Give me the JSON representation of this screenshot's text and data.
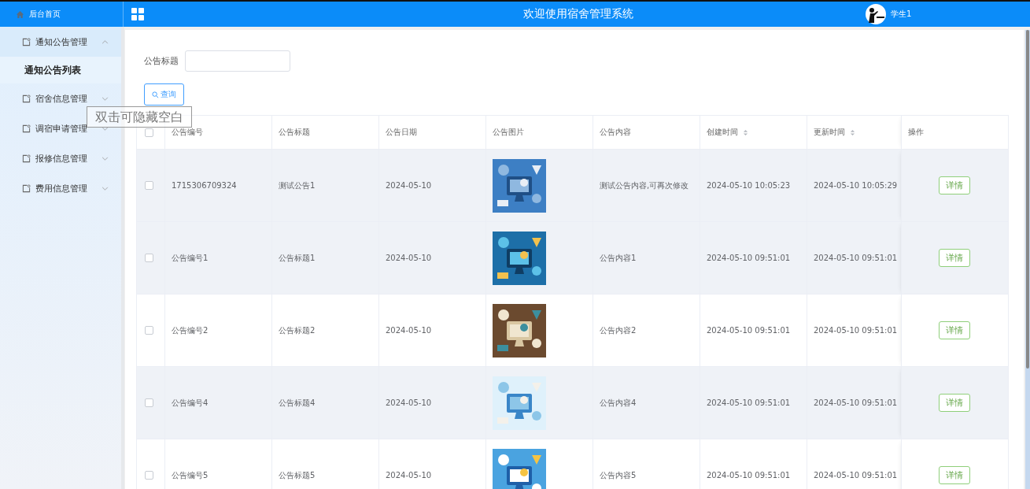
{
  "header": {
    "home_label": "后台首页",
    "title": "欢迎使用宿舍管理系统",
    "user": "学生1"
  },
  "sidebar": {
    "items": [
      {
        "label": "通知公告管理",
        "expanded": true,
        "children": [
          {
            "label": "通知公告列表",
            "selected": true
          }
        ]
      },
      {
        "label": "宿舍信息管理",
        "expanded": false
      },
      {
        "label": "调宿申请管理",
        "expanded": false
      },
      {
        "label": "报修信息管理",
        "expanded": false
      },
      {
        "label": "费用信息管理",
        "expanded": false
      }
    ]
  },
  "tooltip": "双击可隐藏空白",
  "search": {
    "label": "公告标题",
    "button": "查询"
  },
  "table": {
    "select_all_checked": false,
    "columns": [
      {
        "label": "公告编号",
        "sortable": false
      },
      {
        "label": "公告标题",
        "sortable": false
      },
      {
        "label": "公告日期",
        "sortable": false
      },
      {
        "label": "公告图片",
        "sortable": false
      },
      {
        "label": "公告内容",
        "sortable": false
      },
      {
        "label": "创建时间",
        "sortable": true
      },
      {
        "label": "更新时间",
        "sortable": true
      },
      {
        "label": "操作",
        "sortable": false
      }
    ],
    "rows": [
      {
        "highlighted": true,
        "checked": false,
        "cells": [
          {
            "kind": "text",
            "text": "1715306709324"
          },
          {
            "kind": "text",
            "text": "测试公告1"
          },
          {
            "kind": "text",
            "text": "2024-05-10"
          },
          {
            "kind": "picture"
          },
          {
            "kind": "text",
            "text": "测试公告内容,可再次修改"
          },
          {
            "kind": "text",
            "text": "2024-05-10 10:05:23"
          },
          {
            "kind": "text",
            "text": "2024-05-10 10:05:29"
          },
          {
            "kind": "button",
            "text": "详情"
          }
        ]
      },
      {
        "highlighted": true,
        "checked": false,
        "cells": [
          {
            "kind": "text",
            "text": "公告编号1"
          },
          {
            "kind": "text",
            "text": "公告标题1"
          },
          {
            "kind": "text",
            "text": "2024-05-10"
          },
          {
            "kind": "picture"
          },
          {
            "kind": "text",
            "text": "公告内容1"
          },
          {
            "kind": "text",
            "text": "2024-05-10 09:51:01"
          },
          {
            "kind": "text",
            "text": "2024-05-10 09:51:01"
          },
          {
            "kind": "button",
            "text": "详情"
          }
        ]
      },
      {
        "highlighted": false,
        "checked": false,
        "cells": [
          {
            "kind": "text",
            "text": "公告编号2"
          },
          {
            "kind": "text",
            "text": "公告标题2"
          },
          {
            "kind": "text",
            "text": "2024-05-10"
          },
          {
            "kind": "picture"
          },
          {
            "kind": "text",
            "text": "公告内容2"
          },
          {
            "kind": "text",
            "text": "2024-05-10 09:51:01"
          },
          {
            "kind": "text",
            "text": "2024-05-10 09:51:01"
          },
          {
            "kind": "button",
            "text": "详情"
          }
        ]
      },
      {
        "highlighted": true,
        "checked": false,
        "cells": [
          {
            "kind": "text",
            "text": "公告编号4"
          },
          {
            "kind": "text",
            "text": "公告标题4"
          },
          {
            "kind": "text",
            "text": "2024-05-10"
          },
          {
            "kind": "picture"
          },
          {
            "kind": "text",
            "text": "公告内容4"
          },
          {
            "kind": "text",
            "text": "2024-05-10 09:51:01"
          },
          {
            "kind": "text",
            "text": "2024-05-10 09:51:01"
          },
          {
            "kind": "button",
            "text": "详情"
          }
        ]
      },
      {
        "highlighted": false,
        "checked": false,
        "cells": [
          {
            "kind": "text",
            "text": "公告编号5"
          },
          {
            "kind": "text",
            "text": "公告标题5"
          },
          {
            "kind": "text",
            "text": "2024-05-10"
          },
          {
            "kind": "picture"
          },
          {
            "kind": "text",
            "text": "公告内容5"
          },
          {
            "kind": "text",
            "text": "2024-05-10 09:51:01"
          },
          {
            "kind": "text",
            "text": "2024-05-10 09:51:01"
          },
          {
            "kind": "button",
            "text": "详情"
          }
        ]
      }
    ]
  }
}
